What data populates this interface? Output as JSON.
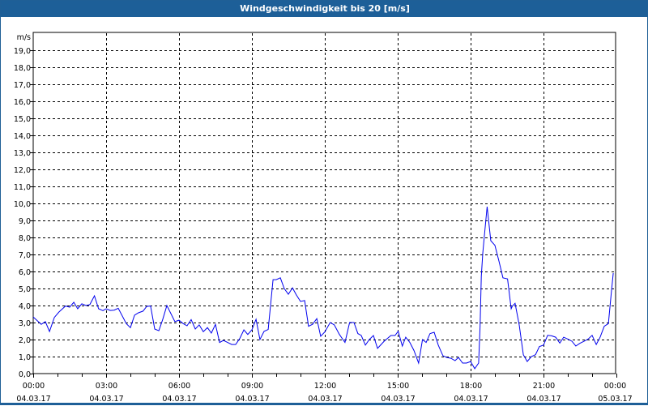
{
  "title": "Windgeschwindigkeit bis 20 [m/s]",
  "colors": {
    "titlebar": "#1d5f98",
    "series": "#0000ee",
    "grid": "#000000"
  },
  "chart_data": {
    "type": "line",
    "title": "Windgeschwindigkeit bis 20 [m/s]",
    "ylabel": "m/s",
    "xlabel": "",
    "ylim": [
      0,
      20
    ],
    "xlim_hours": [
      0,
      24
    ],
    "grid": true,
    "y_ticks": [
      "0,0",
      "1,0",
      "2,0",
      "3,0",
      "4,0",
      "5,0",
      "6,0",
      "7,0",
      "8,0",
      "9,0",
      "10,0",
      "11,0",
      "12,0",
      "13,0",
      "14,0",
      "15,0",
      "16,0",
      "17,0",
      "18,0",
      "19,0"
    ],
    "x_ticks": [
      {
        "hour": 0,
        "time": "00:00",
        "date": "04.03.17"
      },
      {
        "hour": 3,
        "time": "03:00",
        "date": "04.03.17"
      },
      {
        "hour": 6,
        "time": "06:00",
        "date": "04.03.17"
      },
      {
        "hour": 9,
        "time": "09:00",
        "date": "04.03.17"
      },
      {
        "hour": 12,
        "time": "12:00",
        "date": "04.03.17"
      },
      {
        "hour": 15,
        "time": "15:00",
        "date": "04.03.17"
      },
      {
        "hour": 18,
        "time": "18:00",
        "date": "04.03.17"
      },
      {
        "hour": 21,
        "time": "21:00",
        "date": "04.03.17"
      },
      {
        "hour": 24,
        "time": "00:00",
        "date": "05.03.17"
      }
    ],
    "series": [
      {
        "name": "Windgeschwindigkeit",
        "points": [
          [
            0,
            3.33
          ],
          [
            0.33,
            2.89
          ],
          [
            0.5,
            3.05
          ],
          [
            0.67,
            2.47
          ],
          [
            0.87,
            3.3
          ],
          [
            1.06,
            3.62
          ],
          [
            1.33,
            3.97
          ],
          [
            1.5,
            3.9
          ],
          [
            1.67,
            4.19
          ],
          [
            1.83,
            3.81
          ],
          [
            2.0,
            4.1
          ],
          [
            2.17,
            4.0
          ],
          [
            2.33,
            4.05
          ],
          [
            2.52,
            4.57
          ],
          [
            2.69,
            3.81
          ],
          [
            2.87,
            3.7
          ],
          [
            3.0,
            3.81
          ],
          [
            3.17,
            3.71
          ],
          [
            3.33,
            3.73
          ],
          [
            3.5,
            3.84
          ],
          [
            3.83,
            2.94
          ],
          [
            4.0,
            2.7
          ],
          [
            4.17,
            3.43
          ],
          [
            4.33,
            3.57
          ],
          [
            4.52,
            3.67
          ],
          [
            4.67,
            3.95
          ],
          [
            4.83,
            3.97
          ],
          [
            5.0,
            2.62
          ],
          [
            5.17,
            2.52
          ],
          [
            5.33,
            3.18
          ],
          [
            5.5,
            4.0
          ],
          [
            5.83,
            3.05
          ],
          [
            6.0,
            3.14
          ],
          [
            6.17,
            2.94
          ],
          [
            6.33,
            2.81
          ],
          [
            6.5,
            3.17
          ],
          [
            6.67,
            2.62
          ],
          [
            6.83,
            2.86
          ],
          [
            7.0,
            2.46
          ],
          [
            7.17,
            2.7
          ],
          [
            7.33,
            2.38
          ],
          [
            7.5,
            2.89
          ],
          [
            7.67,
            1.83
          ],
          [
            7.83,
            1.95
          ],
          [
            8.0,
            1.83
          ],
          [
            8.17,
            1.71
          ],
          [
            8.33,
            1.71
          ],
          [
            8.5,
            2.06
          ],
          [
            8.67,
            2.57
          ],
          [
            8.83,
            2.3
          ],
          [
            9.0,
            2.57
          ],
          [
            9.17,
            3.19
          ],
          [
            9.33,
            2.0
          ],
          [
            9.5,
            2.48
          ],
          [
            9.67,
            2.59
          ],
          [
            9.87,
            5.52
          ],
          [
            10.0,
            5.52
          ],
          [
            10.17,
            5.63
          ],
          [
            10.33,
            5.0
          ],
          [
            10.5,
            4.66
          ],
          [
            10.67,
            5.04
          ],
          [
            10.83,
            4.62
          ],
          [
            11.0,
            4.24
          ],
          [
            11.17,
            4.29
          ],
          [
            11.33,
            2.78
          ],
          [
            11.5,
            2.9
          ],
          [
            11.67,
            3.23
          ],
          [
            11.83,
            2.19
          ],
          [
            12.0,
            2.45
          ],
          [
            12.22,
            3.0
          ],
          [
            12.39,
            2.86
          ],
          [
            12.6,
            2.3
          ],
          [
            12.83,
            1.83
          ],
          [
            13.02,
            3.0
          ],
          [
            13.2,
            3.0
          ],
          [
            13.36,
            2.35
          ],
          [
            13.5,
            2.24
          ],
          [
            13.67,
            1.67
          ],
          [
            13.83,
            2.0
          ],
          [
            14.0,
            2.24
          ],
          [
            14.17,
            1.48
          ],
          [
            14.44,
            1.9
          ],
          [
            14.72,
            2.24
          ],
          [
            14.89,
            2.24
          ],
          [
            15.02,
            2.49
          ],
          [
            15.19,
            1.62
          ],
          [
            15.33,
            2.14
          ],
          [
            15.5,
            1.83
          ],
          [
            15.67,
            1.35
          ],
          [
            15.86,
            0.62
          ],
          [
            16.02,
            2.0
          ],
          [
            16.17,
            1.83
          ],
          [
            16.33,
            2.35
          ],
          [
            16.5,
            2.43
          ],
          [
            16.67,
            1.67
          ],
          [
            16.86,
            1.05
          ],
          [
            17.02,
            0.95
          ],
          [
            17.19,
            0.9
          ],
          [
            17.36,
            0.76
          ],
          [
            17.5,
            0.95
          ],
          [
            17.67,
            0.62
          ],
          [
            17.83,
            0.62
          ],
          [
            18.0,
            0.71
          ],
          [
            18.17,
            0.29
          ],
          [
            18.33,
            0.62
          ],
          [
            18.39,
            2.78
          ],
          [
            18.44,
            5.71
          ],
          [
            18.5,
            7.06
          ],
          [
            18.56,
            8.0
          ],
          [
            18.68,
            9.81
          ],
          [
            18.83,
            7.81
          ],
          [
            19.0,
            7.54
          ],
          [
            19.17,
            6.59
          ],
          [
            19.33,
            5.63
          ],
          [
            19.52,
            5.56
          ],
          [
            19.67,
            3.81
          ],
          [
            19.72,
            3.97
          ],
          [
            19.83,
            4.13
          ],
          [
            20.0,
            2.86
          ],
          [
            20.17,
            1.11
          ],
          [
            20.33,
            0.71
          ],
          [
            20.5,
            1.0
          ],
          [
            20.67,
            1.11
          ],
          [
            20.83,
            1.59
          ],
          [
            21.0,
            1.67
          ],
          [
            21.17,
            2.25
          ],
          [
            21.33,
            2.22
          ],
          [
            21.5,
            2.14
          ],
          [
            21.67,
            1.79
          ],
          [
            21.83,
            2.14
          ],
          [
            22.0,
            2.03
          ],
          [
            22.17,
            1.9
          ],
          [
            22.33,
            1.62
          ],
          [
            22.5,
            1.78
          ],
          [
            22.67,
            1.9
          ],
          [
            22.83,
            2.02
          ],
          [
            23.0,
            2.25
          ],
          [
            23.17,
            1.71
          ],
          [
            23.33,
            2.14
          ],
          [
            23.5,
            2.78
          ],
          [
            23.67,
            2.94
          ],
          [
            23.78,
            4.6
          ],
          [
            23.87,
            5.9
          ]
        ]
      }
    ]
  }
}
